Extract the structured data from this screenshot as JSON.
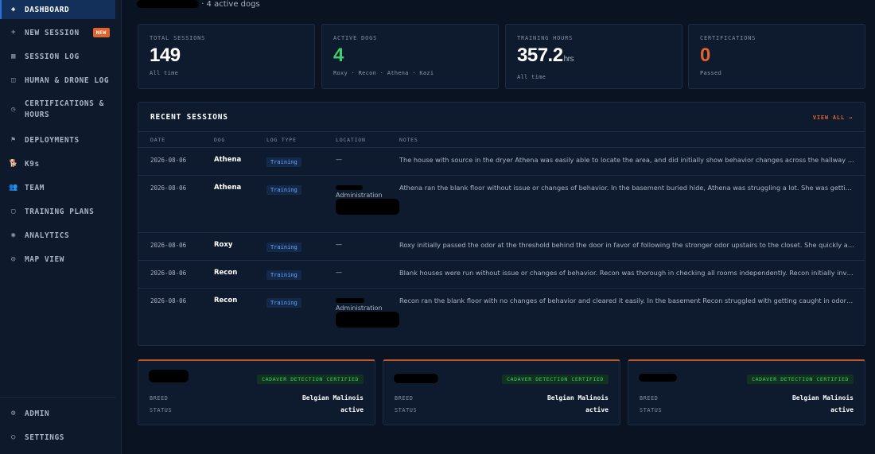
{
  "sidebar": {
    "items": [
      {
        "label": "DASHBOARD",
        "icon": "diamond-icon",
        "glyph": "◈"
      },
      {
        "label": "NEW SESSION",
        "icon": "plus-icon",
        "glyph": "+",
        "badge": "NEW"
      },
      {
        "label": "SESSION LOG",
        "icon": "log-icon",
        "glyph": "▦"
      },
      {
        "label": "HUMAN & DRONE LOG",
        "icon": "grid-icon",
        "glyph": "◫"
      },
      {
        "label": "CERTIFICATIONS & HOURS",
        "icon": "clock-icon",
        "glyph": "◷"
      },
      {
        "label": "DEPLOYMENTS",
        "icon": "flag-icon",
        "glyph": "⚑"
      },
      {
        "label": "K9s",
        "icon": "dog-icon",
        "glyph": "🐕"
      },
      {
        "label": "TEAM",
        "icon": "team-icon",
        "glyph": "👥"
      },
      {
        "label": "TRAINING PLANS",
        "icon": "clipboard-icon",
        "glyph": "▢"
      },
      {
        "label": "ANALYTICS",
        "icon": "analytics-icon",
        "glyph": "◉"
      },
      {
        "label": "MAP VIEW",
        "icon": "map-icon",
        "glyph": "◎"
      }
    ],
    "bottom_items": [
      {
        "label": "ADMIN",
        "icon": "admin-icon",
        "glyph": "⊙"
      },
      {
        "label": "SETTINGS",
        "icon": "settings-icon",
        "glyph": "○"
      }
    ]
  },
  "header": {
    "subtitle_suffix": "· 4 active dogs"
  },
  "stats": [
    {
      "label": "TOTAL SESSIONS",
      "value": "149",
      "unit": "",
      "sub": "All time",
      "color": "#ffffff"
    },
    {
      "label": "ACTIVE DOGS",
      "value": "4",
      "unit": "",
      "sub": "Roxy · Recon · Athena · Kazi",
      "color": "#3fcf6a"
    },
    {
      "label": "TRAINING HOURS",
      "value": "357.2",
      "unit": "hrs",
      "sub": "All time",
      "color": "#ffffff"
    },
    {
      "label": "CERTIFICATIONS",
      "value": "0",
      "unit": "",
      "sub": "Passed",
      "color": "#e0632a"
    }
  ],
  "recent_sessions": {
    "title": "RECENT SESSIONS",
    "view_all": "VIEW ALL →",
    "columns": [
      "DATE",
      "DOG",
      "LOG TYPE",
      "LOCATION",
      "NOTES"
    ],
    "rows": [
      {
        "date": "2026-08-06",
        "dog": "Athena",
        "type": "Training",
        "location": "—",
        "location_admin": "",
        "notes": "The house with source in the dryer Athena was easily able to locate the area, and did initially show behavior changes across the hallway before going to the dryer"
      },
      {
        "date": "2026-08-06",
        "dog": "Athena",
        "type": "Training",
        "location": "",
        "location_admin": "Administration",
        "notes": "Athena ran the blank floor without issue or changes of behavior. In the basement buried hide, Athena was struggling a lot. She was getting drawn away"
      },
      {
        "date": "2026-08-06",
        "dog": "Roxy",
        "type": "Training",
        "location": "—",
        "location_admin": "",
        "notes": "Roxy initially passed the odor at the threshold behind the door in favor of following the stronger odor upstairs to the closet. She quickly and easily"
      },
      {
        "date": "2026-08-06",
        "dog": "Recon",
        "type": "Training",
        "location": "—",
        "location_admin": "",
        "notes": "Blank houses were run without issue or changes of behavior. Recon was thorough in checking all rooms independently. Recon initially investigated"
      },
      {
        "date": "2026-08-06",
        "dog": "Recon",
        "type": "Training",
        "location": "",
        "location_admin": "Administration",
        "notes": "Recon ran the blank floor with no changes of behavior and cleared it easily. In the basement Recon struggled with getting caught in odor flowing up"
      }
    ]
  },
  "k9_cards": [
    {
      "badge": "CADAVER DETECTION CERTIFIED",
      "breed_label": "BREED",
      "breed": "Belgian Malinois",
      "status_label": "STATUS",
      "status": "active"
    },
    {
      "badge": "CADAVER DETECTION CERTIFIED",
      "breed_label": "BREED",
      "breed": "Belgian Malinois",
      "status_label": "STATUS",
      "status": "active"
    },
    {
      "badge": "CADAVER DETECTION CERTIFIED",
      "breed_label": "BREED",
      "breed": "Belgian Malinois",
      "status_label": "STATUS",
      "status": "active"
    }
  ],
  "colors": {
    "accent": "#e0632a",
    "active_nav": "#12305a",
    "success": "#3fcf6a",
    "info": "#6ea8ff"
  }
}
